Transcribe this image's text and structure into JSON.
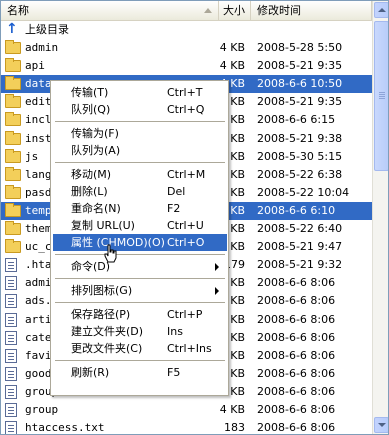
{
  "header": {
    "name": "名称",
    "size": "大小",
    "time": "修改时间"
  },
  "up_row": {
    "label": "上级目录"
  },
  "files": [
    {
      "name": "admin",
      "size": "4 KB",
      "time": "2008-5-28 5:50",
      "type": "folder",
      "selected": false
    },
    {
      "name": "api",
      "size": "4 KB",
      "time": "2008-5-21 9:35",
      "type": "folder",
      "selected": false
    },
    {
      "name": "data",
      "size": "4 KB",
      "time": "2008-6-6 10:50",
      "type": "folder",
      "selected": true
    },
    {
      "name": "edito",
      "size": "4 KB",
      "time": "2008-5-21 9:35",
      "type": "folder",
      "selected": false
    },
    {
      "name": "inclu",
      "size": "4 KB",
      "time": "2008-6-6 6:15",
      "type": "folder",
      "selected": false
    },
    {
      "name": "insta",
      "size": "4 KB",
      "time": "2008-5-21 9:38",
      "type": "folder",
      "selected": false
    },
    {
      "name": "js",
      "size": "4 KB",
      "time": "2008-5-30 5:15",
      "type": "folder",
      "selected": false
    },
    {
      "name": "langu",
      "size": "4 KB",
      "time": "2008-5-22 6:38",
      "type": "folder",
      "selected": false
    },
    {
      "name": "pasdw",
      "size": "4 KB",
      "time": "2008-5-22 10:04",
      "type": "folder",
      "selected": false
    },
    {
      "name": "temp",
      "size": "4 KB",
      "time": "2008-6-6 6:10",
      "type": "folder",
      "selected": true
    },
    {
      "name": "theme",
      "size": "4 KB",
      "time": "2008-5-22 6:40",
      "type": "folder",
      "selected": false
    },
    {
      "name": "uc_cl",
      "size": "4 KB",
      "time": "2008-5-21 9:47",
      "type": "folder",
      "selected": false
    },
    {
      "name": ".htac",
      "size": "179",
      "time": "2008-5-21 9:32",
      "type": "file",
      "selected": false
    },
    {
      "name": "admin",
      "size": "4 KB",
      "time": "2008-6-6 8:06",
      "type": "file",
      "selected": false
    },
    {
      "name": "ads.p",
      "size": "4 KB",
      "time": "2008-6-6 8:06",
      "type": "file",
      "selected": false
    },
    {
      "name": "artic",
      "size": "4 KB",
      "time": "2008-6-6 8:06",
      "type": "file",
      "selected": false
    },
    {
      "name": "categ",
      "size": "4 KB",
      "time": "2008-6-6 8:06",
      "type": "file",
      "selected": false
    },
    {
      "name": "favic",
      "size": "4 KB",
      "time": "2008-6-6 8:06",
      "type": "file",
      "selected": false
    },
    {
      "name": "goods",
      "size": "4 KB",
      "time": "2008-6-6 8:06",
      "type": "file",
      "selected": false
    },
    {
      "name": "group",
      "size": "4 KB",
      "time": "2008-6-6 8:06",
      "type": "file",
      "selected": false
    },
    {
      "name": "group",
      "size": "4 KB",
      "time": "2008-6-6 8:06",
      "type": "file",
      "selected": false
    },
    {
      "name": "htaccess.txt",
      "size": "183",
      "time": "2008-6-6 8:06",
      "type": "file",
      "selected": false
    }
  ],
  "context_menu": {
    "items": [
      {
        "label": "传输(T)",
        "shortcut": "Ctrl+T",
        "highlighted": false,
        "submenu": false,
        "sep_before": false
      },
      {
        "label": "队列(Q)",
        "shortcut": "Ctrl+Q",
        "highlighted": false,
        "submenu": false,
        "sep_before": false
      },
      {
        "label": "传输为(F)",
        "shortcut": "",
        "highlighted": false,
        "submenu": false,
        "sep_before": true
      },
      {
        "label": "队列为(A)",
        "shortcut": "",
        "highlighted": false,
        "submenu": false,
        "sep_before": false
      },
      {
        "label": "移动(M)",
        "shortcut": "Ctrl+M",
        "highlighted": false,
        "submenu": false,
        "sep_before": true
      },
      {
        "label": "删除(L)",
        "shortcut": "Del",
        "highlighted": false,
        "submenu": false,
        "sep_before": false
      },
      {
        "label": "重命名(N)",
        "shortcut": "F2",
        "highlighted": false,
        "submenu": false,
        "sep_before": false
      },
      {
        "label": "复制 URL(U)",
        "shortcut": "Ctrl+U",
        "highlighted": false,
        "submenu": false,
        "sep_before": false
      },
      {
        "label": "属性 (CHMOD)(O)",
        "shortcut": "Ctrl+O",
        "highlighted": true,
        "submenu": false,
        "sep_before": false
      },
      {
        "label": "命令(D)",
        "shortcut": "",
        "highlighted": false,
        "submenu": true,
        "sep_before": true
      },
      {
        "label": "排列图标(G)",
        "shortcut": "",
        "highlighted": false,
        "submenu": true,
        "sep_before": true
      },
      {
        "label": "保存路径(P)",
        "shortcut": "Ctrl+P",
        "highlighted": false,
        "submenu": false,
        "sep_before": true
      },
      {
        "label": "建立文件夹(D)",
        "shortcut": "Ins",
        "highlighted": false,
        "submenu": false,
        "sep_before": false
      },
      {
        "label": "更改文件夹(C)",
        "shortcut": "Ctrl+Ins",
        "highlighted": false,
        "submenu": false,
        "sep_before": false
      },
      {
        "label": "刷新(R)",
        "shortcut": "F5",
        "highlighted": false,
        "submenu": false,
        "sep_before": true
      }
    ]
  },
  "colors": {
    "selection": "#316ac5",
    "folder": "#f3cf5a",
    "menu_border": "#aca899"
  }
}
